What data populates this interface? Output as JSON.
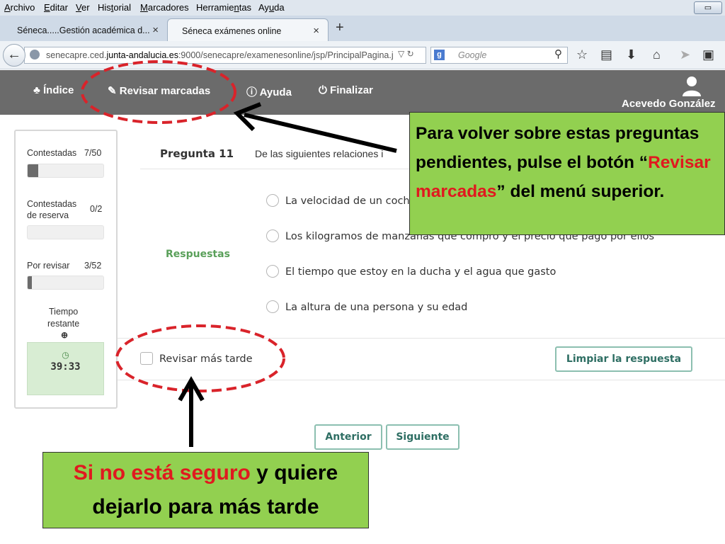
{
  "browser": {
    "menu": [
      "Archivo",
      "Editar",
      "Ver",
      "Historial",
      "Marcadores",
      "Herramientas",
      "Ayuda"
    ],
    "tabs": [
      {
        "label": "Séneca.....Gestión académica d...",
        "close": "×"
      },
      {
        "label": "Séneca exámenes online",
        "close": "×"
      }
    ],
    "new_tab": "+",
    "url_pre": "senecapre.ced.",
    "url_domain": "junta-andalucia.es",
    "url_post": ":9000/senecapre/examenesonline/jsp/PrincipalPagina.j",
    "search_placeholder": "Google",
    "search_engine": "g"
  },
  "app": {
    "nav": [
      {
        "icon": "sitemap-icon",
        "label": "Índice"
      },
      {
        "icon": "pencil-icon",
        "label": "Revisar marcadas"
      },
      {
        "icon": "info-icon",
        "label": "Ayuda"
      },
      {
        "icon": "power-icon",
        "label": "Finalizar"
      }
    ],
    "user_name": "Acevedo González"
  },
  "progress": {
    "answered_label": "Contestadas",
    "answered_value": "7/50",
    "answered_fraction": 0.14,
    "reserve_label_1": "Contestadas",
    "reserve_label_2": "de reserva",
    "reserve_value": "0/2",
    "reserve_fraction": 0,
    "review_label": "Por revisar",
    "review_value": "3/52",
    "review_fraction": 0.058,
    "time_label_1": "Tiempo",
    "time_label_2": "restante",
    "timer": "39:33"
  },
  "question": {
    "label": "Pregunta 11",
    "text": "De las siguientes relaciones i",
    "answers_label": "Respuestas",
    "options": [
      "La velocidad de un coch",
      "Los kilogramos de manzanas que compro y el precio que pago por ellos",
      "El tiempo que estoy en la ducha y el agua que gasto",
      "La altura de una persona y su edad"
    ],
    "review_later": "Revisar más tarde",
    "clear_button": "Limpiar la respuesta",
    "prev_button": "Anterior",
    "next_button": "Siguiente"
  },
  "annotations": {
    "callout1_a": "Para volver sobre estas preguntas pendientes, pulse el botón “",
    "callout1_red": "Revisar marcadas",
    "callout1_b": "” del menú superior.",
    "callout2_red": "Si no está seguro",
    "callout2_b": " y quiere dejarlo para más tarde",
    "accent_red": "#e0191f",
    "callout_green": "#92d050"
  }
}
